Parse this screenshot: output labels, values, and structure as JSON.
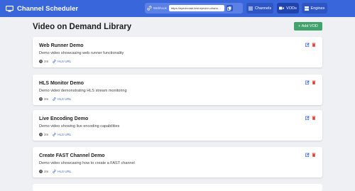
{
  "app": {
    "title": "Channel Scheduler"
  },
  "nav": {
    "webhook_label": "Webhook",
    "webhook_url": "https://eyevinnlab-test.eyevinn-channel-sc",
    "channels_label": "Channels",
    "vods_label": "VODs",
    "engines_label": "Engines"
  },
  "page": {
    "title": "Video on Demand Library",
    "add_label": "+ Add VOD"
  },
  "vods": [
    {
      "title": "Web Runner Demo",
      "description": "Demo video showcasing web runner functionality",
      "duration": "2m",
      "link_label": "HLS URL"
    },
    {
      "title": "HLS Monitor Demo",
      "description": "Demo video demonstrating HLS stream monitoring",
      "duration": "2m",
      "link_label": "HLS URL"
    },
    {
      "title": "Live Encoding Demo",
      "description": "Demo video showing live encoding capabilities",
      "duration": "2m",
      "link_label": "HLS URL"
    },
    {
      "title": "Create FAST Channel Demo",
      "description": "Demo video showcasing how to create a FAST channel",
      "duration": "2m",
      "link_label": "HLS URL"
    }
  ],
  "colors": {
    "navbar": "#3a66db",
    "add_button": "#3fa36b",
    "edit_icon": "#3a66db",
    "delete_icon": "#d9433a"
  }
}
